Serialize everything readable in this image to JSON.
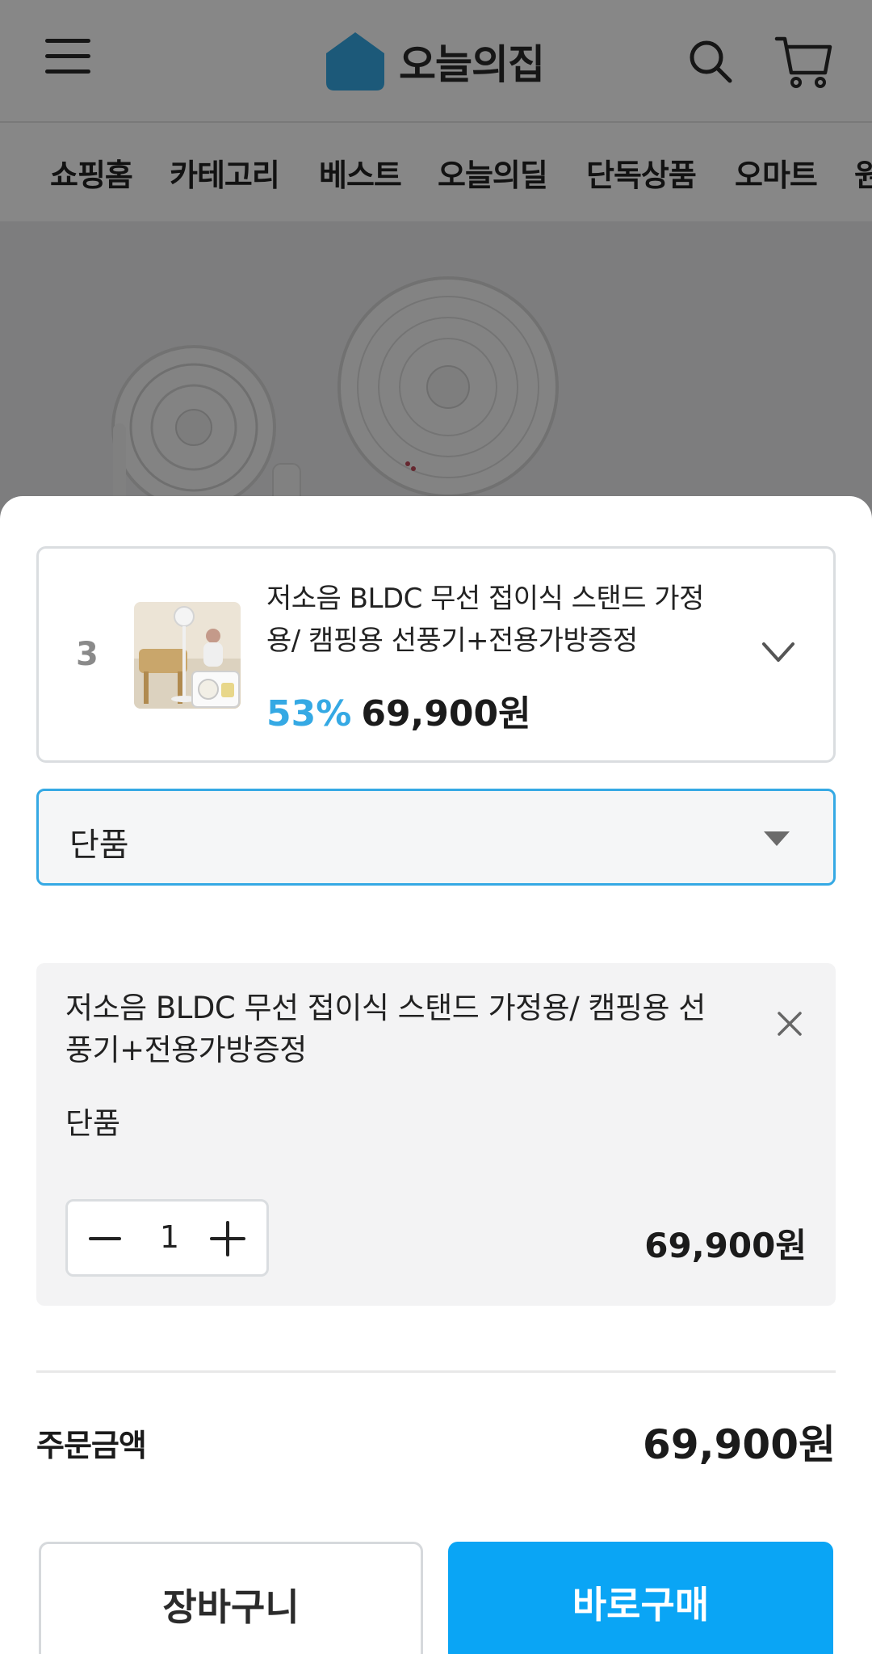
{
  "app": {
    "logo_text": "오늘의집",
    "brand_color": "#35a9e4"
  },
  "header": {
    "menu_icon": "hamburger-icon",
    "search_icon": "search-icon",
    "cart_icon": "cart-icon"
  },
  "nav": {
    "tabs": [
      "쇼핑홈",
      "카테고리",
      "베스트",
      "오늘의딜",
      "단독상품",
      "오마트",
      "원"
    ]
  },
  "sheet": {
    "product": {
      "rank": "3",
      "name": "저소음 BLDC 무선 접이식 스탠드 가정용/ 캠핑용 선풍기+전용가방증정",
      "discount": "53%",
      "price": "69,900원"
    },
    "option_select": {
      "value": "단품"
    },
    "selected_item": {
      "name": "저소음 BLDC 무선 접이식 스탠드 가정용/ 캠핑용 선풍기+전용가방증정",
      "option": "단품",
      "quantity": "1",
      "price": "69,900원"
    },
    "total": {
      "label": "주문금액",
      "value": "69,900원"
    },
    "buttons": {
      "cart": "장바구니",
      "buy": "바로구매"
    }
  }
}
